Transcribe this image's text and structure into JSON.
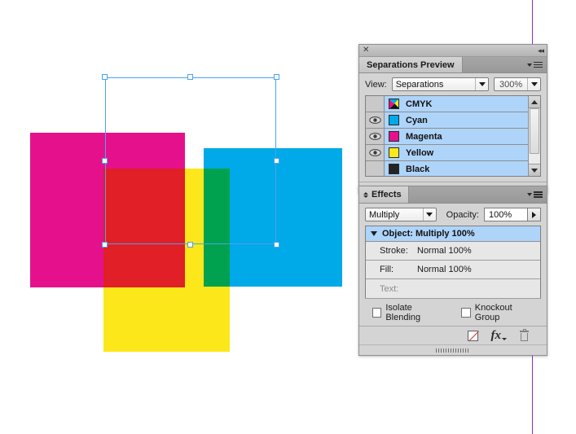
{
  "artwork": {
    "shapes": [
      {
        "name": "magenta-square",
        "color": "#e5118c"
      },
      {
        "name": "cyan-square",
        "color": "#00a9e7"
      },
      {
        "name": "yellow-square",
        "color": "#fce81a"
      },
      {
        "name": "magenta-yellow-overlap",
        "color": "#e01f26"
      },
      {
        "name": "cyan-yellow-overlap",
        "color": "#00a14f"
      }
    ],
    "guide_color": "#8a2be2",
    "selection_color": "#4aa3f0"
  },
  "separations_panel": {
    "close_label": "✕",
    "collapse_label": "◂◂",
    "tab_label": "Separations Preview",
    "view_label": "View:",
    "view_value": "Separations",
    "zoom_value": "300%",
    "rows": [
      {
        "name": "CMYK",
        "eye": false,
        "swatch": "cmyk"
      },
      {
        "name": "Cyan",
        "eye": true,
        "swatch": "#00a9e7"
      },
      {
        "name": "Magenta",
        "eye": true,
        "swatch": "#e5118c"
      },
      {
        "name": "Yellow",
        "eye": true,
        "swatch": "#fce81a"
      },
      {
        "name": "Black",
        "eye": false,
        "swatch": "#1c1c1c"
      }
    ]
  },
  "effects_panel": {
    "tab_label": "Effects",
    "blend_mode": "Multiply",
    "opacity_label": "Opacity:",
    "opacity_value": "100%",
    "object_row": "Object: Multiply 100%",
    "stroke_key": "Stroke:",
    "stroke_value": "Normal 100%",
    "fill_key": "Fill:",
    "fill_value": "Normal 100%",
    "text_key": "Text:",
    "text_value": "",
    "isolate_blending": "Isolate Blending",
    "knockout_group": "Knockout Group"
  }
}
